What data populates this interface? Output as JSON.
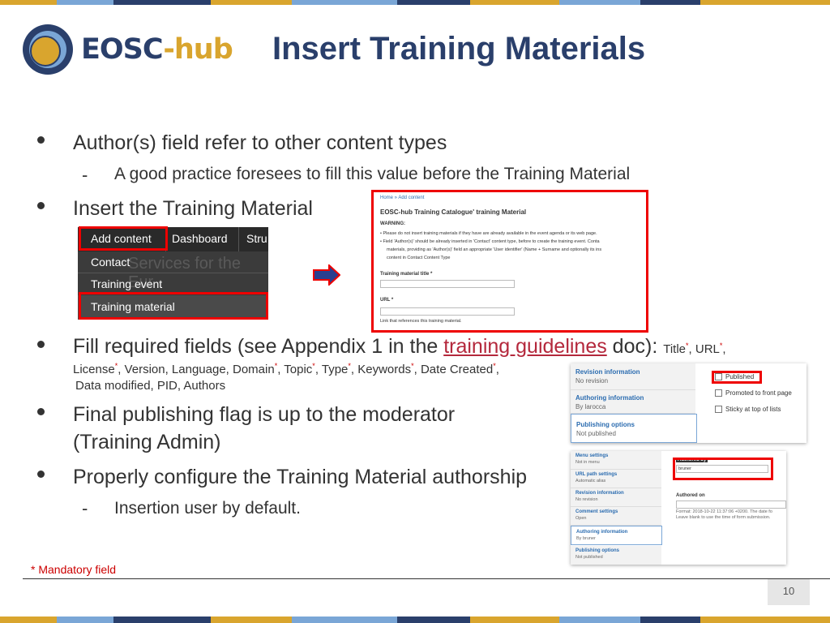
{
  "brand": {
    "name_part1": "EOSC",
    "name_part2": "-hub",
    "color_blue": "#2a3f6b",
    "color_gold": "#d9a52e"
  },
  "slide": {
    "title": "Insert Training Materials",
    "page_number": "10",
    "mandatory_note": "* Mandatory field"
  },
  "bullets": {
    "b1": "Author(s) field refer to other content types",
    "b1_sub": "A good practice foresees to fill this value before the Training Material",
    "b2": "Insert the Training Material",
    "b3_pre": "Fill required fields (see Appendix 1 in the ",
    "b3_link": "training guidelines",
    "b3_post": " doc):",
    "b3_title": "Title",
    "b3_url": "URL",
    "b3_license": "License",
    "b3_line2a": ", Version, Language, Domain",
    "b3_topic": ", Topic",
    "b3_type": ", Type",
    "b3_keywords": ", Keywords",
    "b3_date": ", Date Created",
    "b3_line3": "Data modified, PID, Authors",
    "b4_line1": "Final publishing flag is up to the moderator",
    "b4_line2": "(Training Admin)",
    "b5": "Properly configure the Training Material authorship",
    "b5_sub": "Insertion user by default.",
    "asterisk": "*",
    "comma": ","
  },
  "admin_menu": {
    "add_content": "Add content",
    "dashboard": "Dashboard",
    "structure": "Stru",
    "contact": "Contact",
    "training_event": "Training event",
    "training_material": "Training material",
    "bg_text": "Services for the Eur"
  },
  "form_shot": {
    "breadcrumb": "Home » Add content",
    "heading": "EOSC-hub Training Catalogue' training Material",
    "warning": "WARNING:",
    "p1": "•  Please do not insert training materials if they have are already available in the event agenda or its web page.",
    "p2": "•  Field 'Author(s)' should be already inserted in 'Contact' content type, before to create the training event. Conta",
    "p3": "materials, providing as 'Author(s)' field an appropriate 'User identifier' (Name + Surname and optionally its ins",
    "p4": "content in Contact Content Type",
    "title_label": "Training material title *",
    "url_label": "URL *",
    "url_help": "Link that references this training material."
  },
  "publish_panel": {
    "rev_title": "Revision information",
    "rev_sub": "No revision",
    "auth_title": "Authoring information",
    "auth_sub": "By larocca",
    "pub_title": "Publishing options",
    "pub_sub": "Not published",
    "published": "Published",
    "promoted": "Promoted to front page",
    "sticky": "Sticky at top of lists"
  },
  "authoring_panel": {
    "tabs": [
      {
        "title": "Menu settings",
        "sub": "Not in menu"
      },
      {
        "title": "URL path settings",
        "sub": "Automatic alias"
      },
      {
        "title": "Revision information",
        "sub": "No revision"
      },
      {
        "title": "Comment settings",
        "sub": "Open"
      },
      {
        "title": "Authoring information",
        "sub": "By bruner"
      },
      {
        "title": "Publishing options",
        "sub": "Not published"
      }
    ],
    "authored_by": "Authored by",
    "author_value": "bruner",
    "authored_on": "Authored on",
    "format_line1": "Format: 2018-10-22 11:37:06 +0200. The date fo",
    "format_line2": "Leave blank to use the time of form submission."
  }
}
